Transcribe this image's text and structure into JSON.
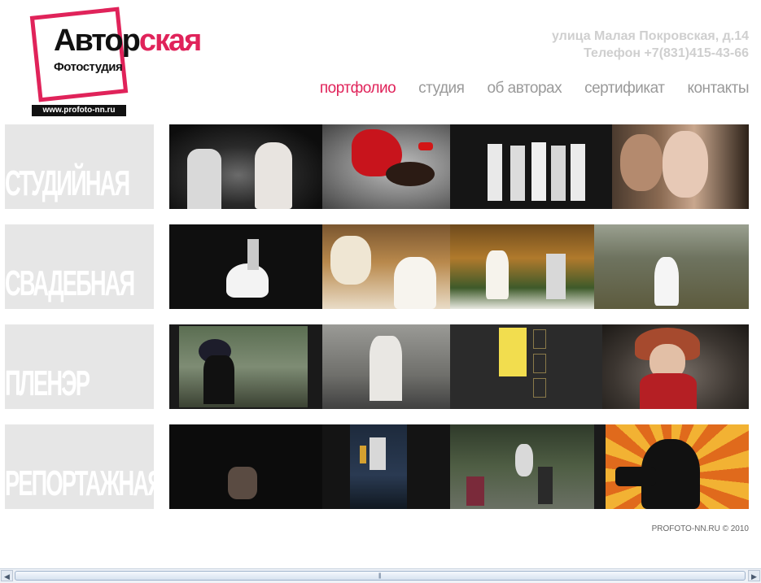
{
  "logo": {
    "line1_dark": "Автор",
    "line1_accent": "ская",
    "line2": "Фотостудия",
    "url": "www.profoto-nn.ru",
    "accent_color": "#e0235a"
  },
  "contact": {
    "address": "улица Малая Покровская, д.14",
    "phone": "Телефон +7(831)415-43-66"
  },
  "nav": {
    "items": [
      {
        "label": "портфолио",
        "active": true
      },
      {
        "label": "студия",
        "active": false
      },
      {
        "label": "об авторах",
        "active": false
      },
      {
        "label": "сертификат",
        "active": false
      },
      {
        "label": "контакты",
        "active": false
      }
    ]
  },
  "rows": [
    {
      "label": "СТУДИЙНАЯ"
    },
    {
      "label": "СВАДЕБНАЯ"
    },
    {
      "label": "ПЛЕНЭР"
    },
    {
      "label": "РЕПОРТАЖНАЯ"
    }
  ],
  "footer": {
    "copyright": "PROFOTO-NN.RU © 2010"
  },
  "scrollbar": {
    "left_arrow": "◀",
    "right_arrow": "▶",
    "grip": "|||"
  }
}
